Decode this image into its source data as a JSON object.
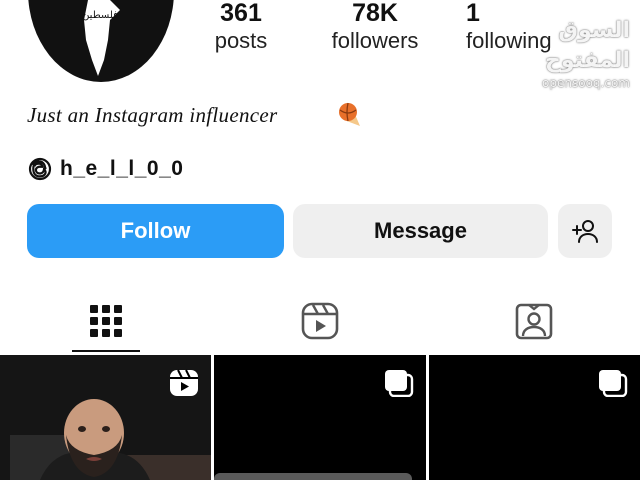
{
  "profile": {
    "avatar_text": "فلسطين",
    "stats": [
      {
        "value": "361",
        "label": "posts"
      },
      {
        "value": "78K",
        "label": "followers"
      },
      {
        "value": "1",
        "label": "following"
      }
    ],
    "bio": "Just an Instagram influencer",
    "threads_handle": "h_e_l_l_0_0"
  },
  "actions": {
    "follow_label": "Follow",
    "message_label": "Message"
  },
  "tabs": [
    {
      "icon": "grid-icon",
      "selected": true
    },
    {
      "icon": "reels-icon",
      "selected": false
    },
    {
      "icon": "tagged-icon",
      "selected": false
    }
  ],
  "watermark": {
    "arabic": "السوق المفتوح",
    "latin": "opensooq.com"
  },
  "colors": {
    "follow_blue": "#2b9cf6",
    "button_gray": "#efefef",
    "grid_black": "#000000"
  }
}
